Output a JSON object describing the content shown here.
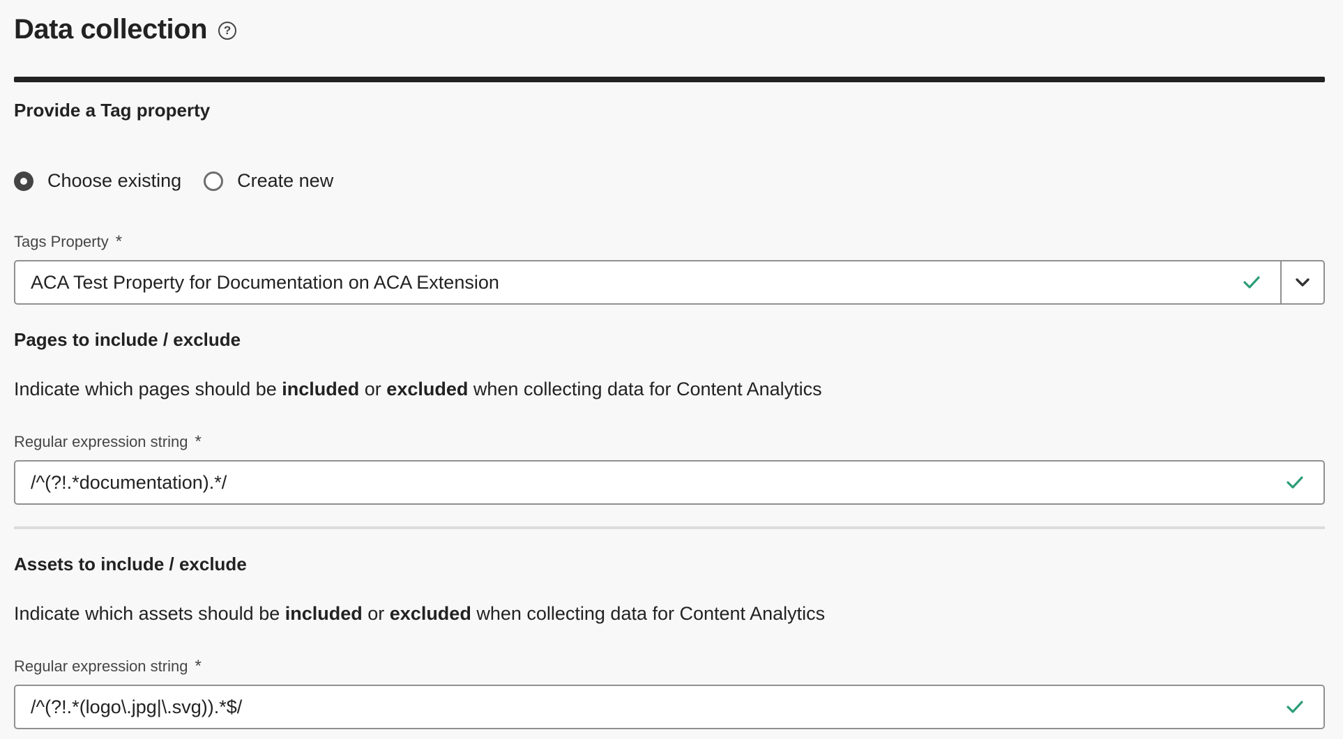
{
  "header": {
    "title": "Data collection",
    "help_icon": "help-circle-icon"
  },
  "tag_section": {
    "heading": "Provide a Tag property",
    "radio_options": [
      {
        "label": "Choose existing",
        "selected": true
      },
      {
        "label": "Create new",
        "selected": false
      }
    ],
    "field_label": "Tags Property",
    "required_mark": "*",
    "value": "ACA Test Property for Documentation on ACA Extension",
    "valid_icon": "checkmark-icon",
    "dropdown_icon": "chevron-down-icon"
  },
  "pages_section": {
    "heading": "Pages to include / exclude",
    "description_parts": [
      "Indicate which pages should be ",
      "included",
      " or ",
      "excluded",
      " when collecting data for Content Analytics"
    ],
    "field_label": "Regular expression string",
    "required_mark": "*",
    "value": "/^(?!.*documentation).*/",
    "valid_icon": "checkmark-icon"
  },
  "assets_section": {
    "heading": "Assets to include / exclude",
    "description_parts": [
      "Indicate which assets should be ",
      "included",
      " or ",
      "excluded",
      " when collecting data for Content Analytics"
    ],
    "field_label": "Regular expression string",
    "required_mark": "*",
    "value": "/^(?!.*(logo\\.jpg|\\.svg)).*$/",
    "valid_icon": "checkmark-icon"
  },
  "colors": {
    "valid": "#2d9d78",
    "text": "#222222",
    "background": "#f8f8f8",
    "border": "#909090"
  }
}
